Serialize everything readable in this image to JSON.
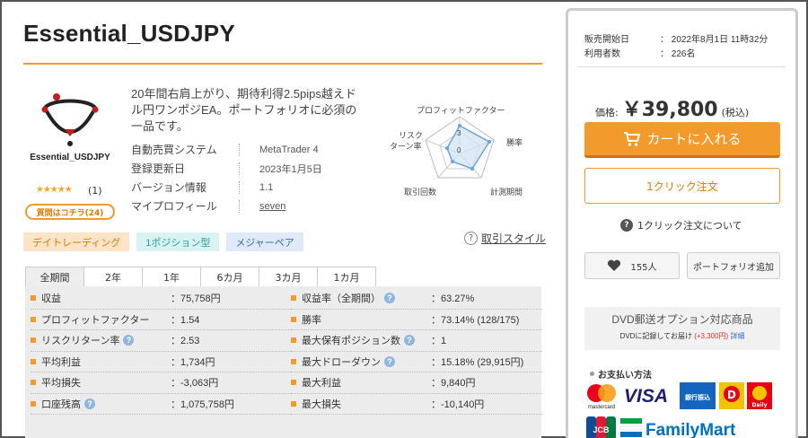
{
  "title": "Essential_USDJPY",
  "product": {
    "logo_name": "Essential_USDJPY",
    "stars": "★★★★★",
    "review_count": "(1)",
    "qa_button": "質問はコチラ(24)",
    "description": "20年間右肩上がり、期待利得2.5pips越えドル円ワンポジEA。ポートフォリオに必須の一品です。",
    "info": [
      {
        "key": "自動売買システム",
        "value": "MetaTrader 4"
      },
      {
        "key": "登録更新日",
        "value": "2023年1月5日"
      },
      {
        "key": "バージョン情報",
        "value": "1.1"
      },
      {
        "key": "マイプロフィール",
        "value": "seven"
      }
    ]
  },
  "radar": {
    "labels": {
      "top": "プロフィットファクター",
      "right": "勝率",
      "bottom_right": "計測期間",
      "bottom_left": "取引回数",
      "left_line1": "リスク",
      "left_line2": "ターン率"
    },
    "tick_3": "3",
    "tick_0": "0"
  },
  "tags": [
    "デイトレーディング",
    "1ポジション型",
    "メジャーペア"
  ],
  "trade_style_link": "取引スタイル",
  "tabs": [
    "全期間",
    "2年",
    "1年",
    "6カ月",
    "3カ月",
    "1カ月"
  ],
  "stats_left": [
    {
      "label": "収益",
      "value": "：75,758円",
      "help": false
    },
    {
      "label": "プロフィットファクター",
      "value": "：1.54",
      "help": false
    },
    {
      "label": "リスクリターン率",
      "value": "：2.53",
      "help": true
    },
    {
      "label": "平均利益",
      "value": "：1,734円",
      "help": false
    },
    {
      "label": "平均損失",
      "value": "：-3,063円",
      "help": false
    },
    {
      "label": "口座残高",
      "value": "：1,075,758円",
      "help": true
    }
  ],
  "stats_right": [
    {
      "label": "収益率（全期間）",
      "value": "：63.27%",
      "help": true
    },
    {
      "label": "勝率",
      "value": "：73.14% (128/175)",
      "help": false
    },
    {
      "label": "最大保有ポジション数",
      "value": "：1",
      "help": true
    },
    {
      "label": "最大ドローダウン",
      "value": "：15.18% (29,915円)",
      "help": true
    },
    {
      "label": "最大利益",
      "value": "：9,840円",
      "help": false
    },
    {
      "label": "最大損失",
      "value": "：-10,140円",
      "help": false
    }
  ],
  "sidebar": {
    "release_label": "販売開始日",
    "release_value": "：  2022年8月1日 11時32分",
    "users_label": "利用者数",
    "users_value": "：  226名",
    "price_label": "価格:",
    "price_value": "￥39,800",
    "price_tax": "(税込)",
    "cart_button": "カートに入れる",
    "oneclick_button": "1クリック注文",
    "oneclick_about": "1クリック注文について",
    "fav_count": "155人",
    "portfolio_button": "ポートフォリオ追加",
    "dvd_title": "DVD郵送オプション対応商品",
    "dvd_note": "DVDに記録してお届け",
    "dvd_price": "(+3,300円)",
    "dvd_link": "詳細",
    "payment_title": "お支払い方法",
    "payment_text": {
      "mastercard": "mastercard",
      "visa": "VISA",
      "bank": "銀行振込",
      "daily": "Daily",
      "jcb": "JCB",
      "familymart": "FamilyMart"
    }
  },
  "colors": {
    "accent": "#f39a2d",
    "radar_fill": "#cfe3f6",
    "radar_stroke": "#6aa3dd"
  }
}
